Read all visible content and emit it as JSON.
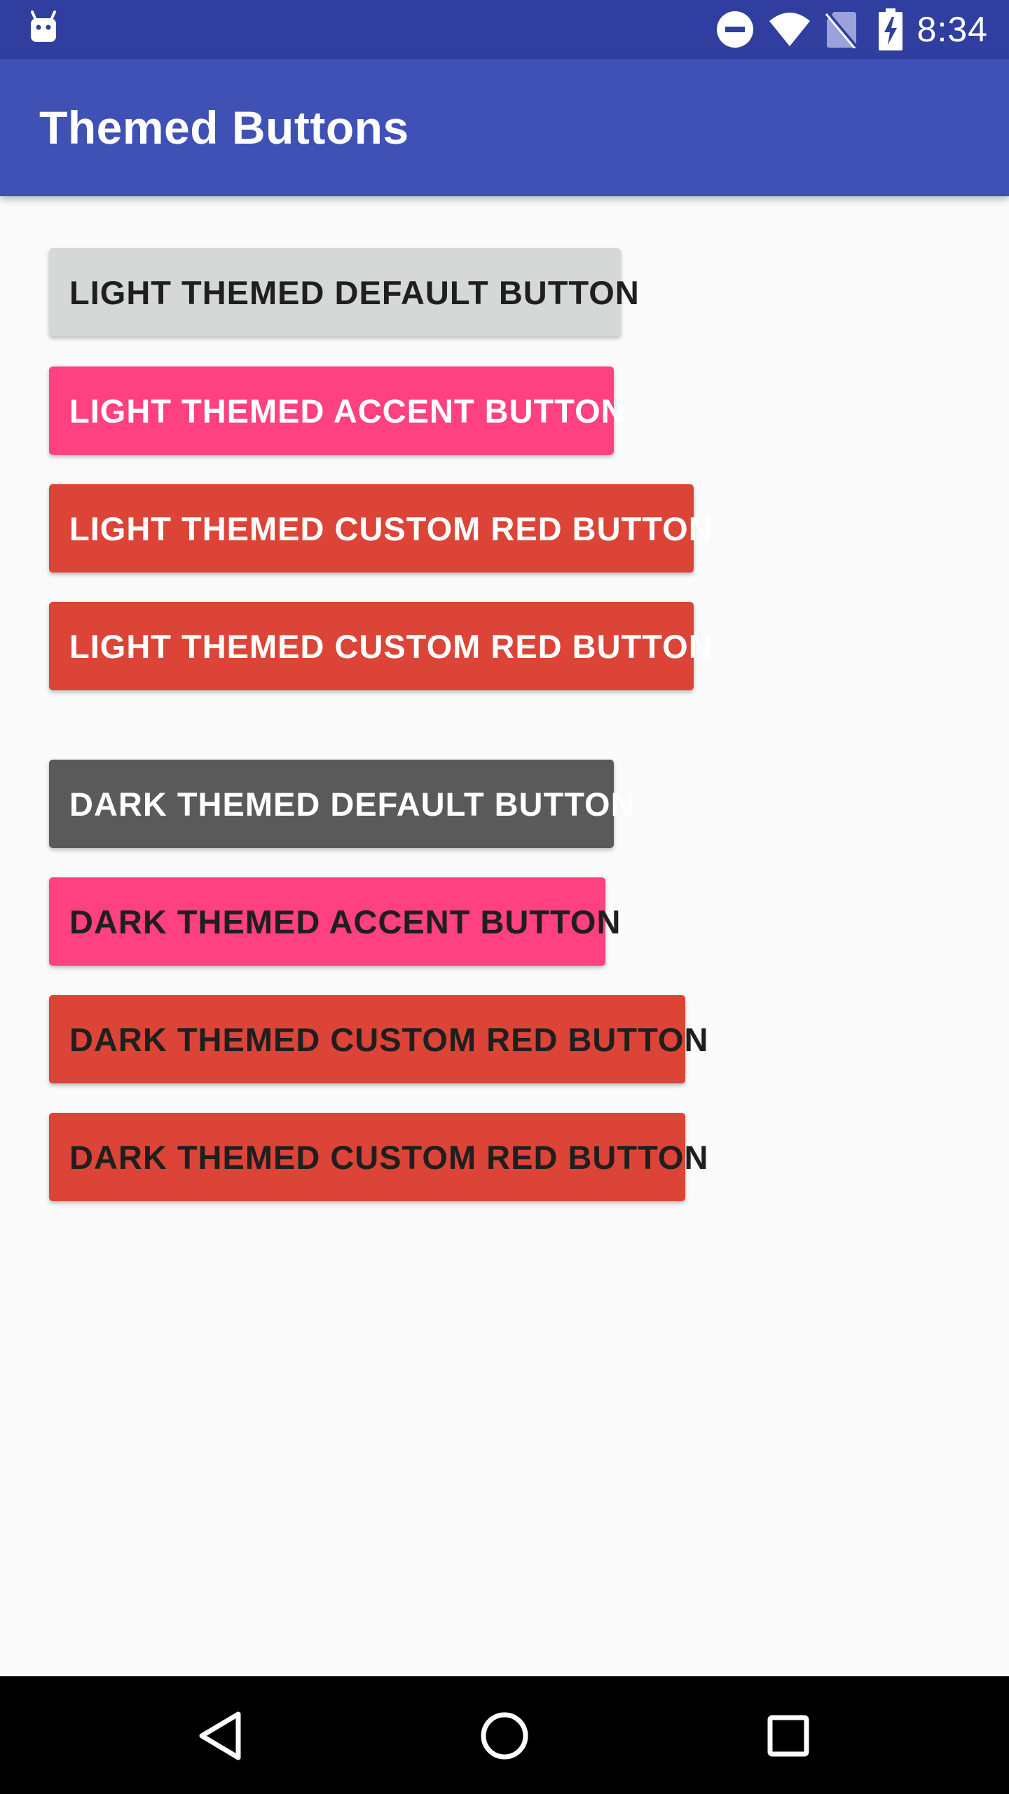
{
  "status_bar": {
    "time": "8:34",
    "icons": [
      "android-debug-icon",
      "do-not-disturb-icon",
      "wifi-icon",
      "no-sim-icon",
      "battery-charging-icon"
    ]
  },
  "app_bar": {
    "title": "Themed Buttons",
    "color": "#3f51b5"
  },
  "buttons": {
    "light_default": "LIGHT THEMED DEFAULT BUTTON",
    "light_accent": "LIGHT THEMED ACCENT BUTTON",
    "light_custom_red_1": "LIGHT THEMED CUSTOM RED BUTTON",
    "light_custom_red_2": "LIGHT THEMED CUSTOM RED BUTTON",
    "dark_default": "DARK THEMED DEFAULT BUTTON",
    "dark_accent": "DARK THEMED ACCENT BUTTON",
    "dark_custom_red_1": "DARK THEMED CUSTOM RED BUTTON",
    "dark_custom_red_2": "DARK THEMED CUSTOM RED BUTTON"
  },
  "colors": {
    "status_bar": "#303f9f",
    "accent": "#ff4081",
    "custom_red": "#dc4437",
    "light_default": "#d6d7d7",
    "dark_default": "#5a5a5b",
    "background": "#fafafa"
  },
  "nav_bar": {
    "icons": [
      "back-icon",
      "home-icon",
      "recents-icon"
    ]
  }
}
